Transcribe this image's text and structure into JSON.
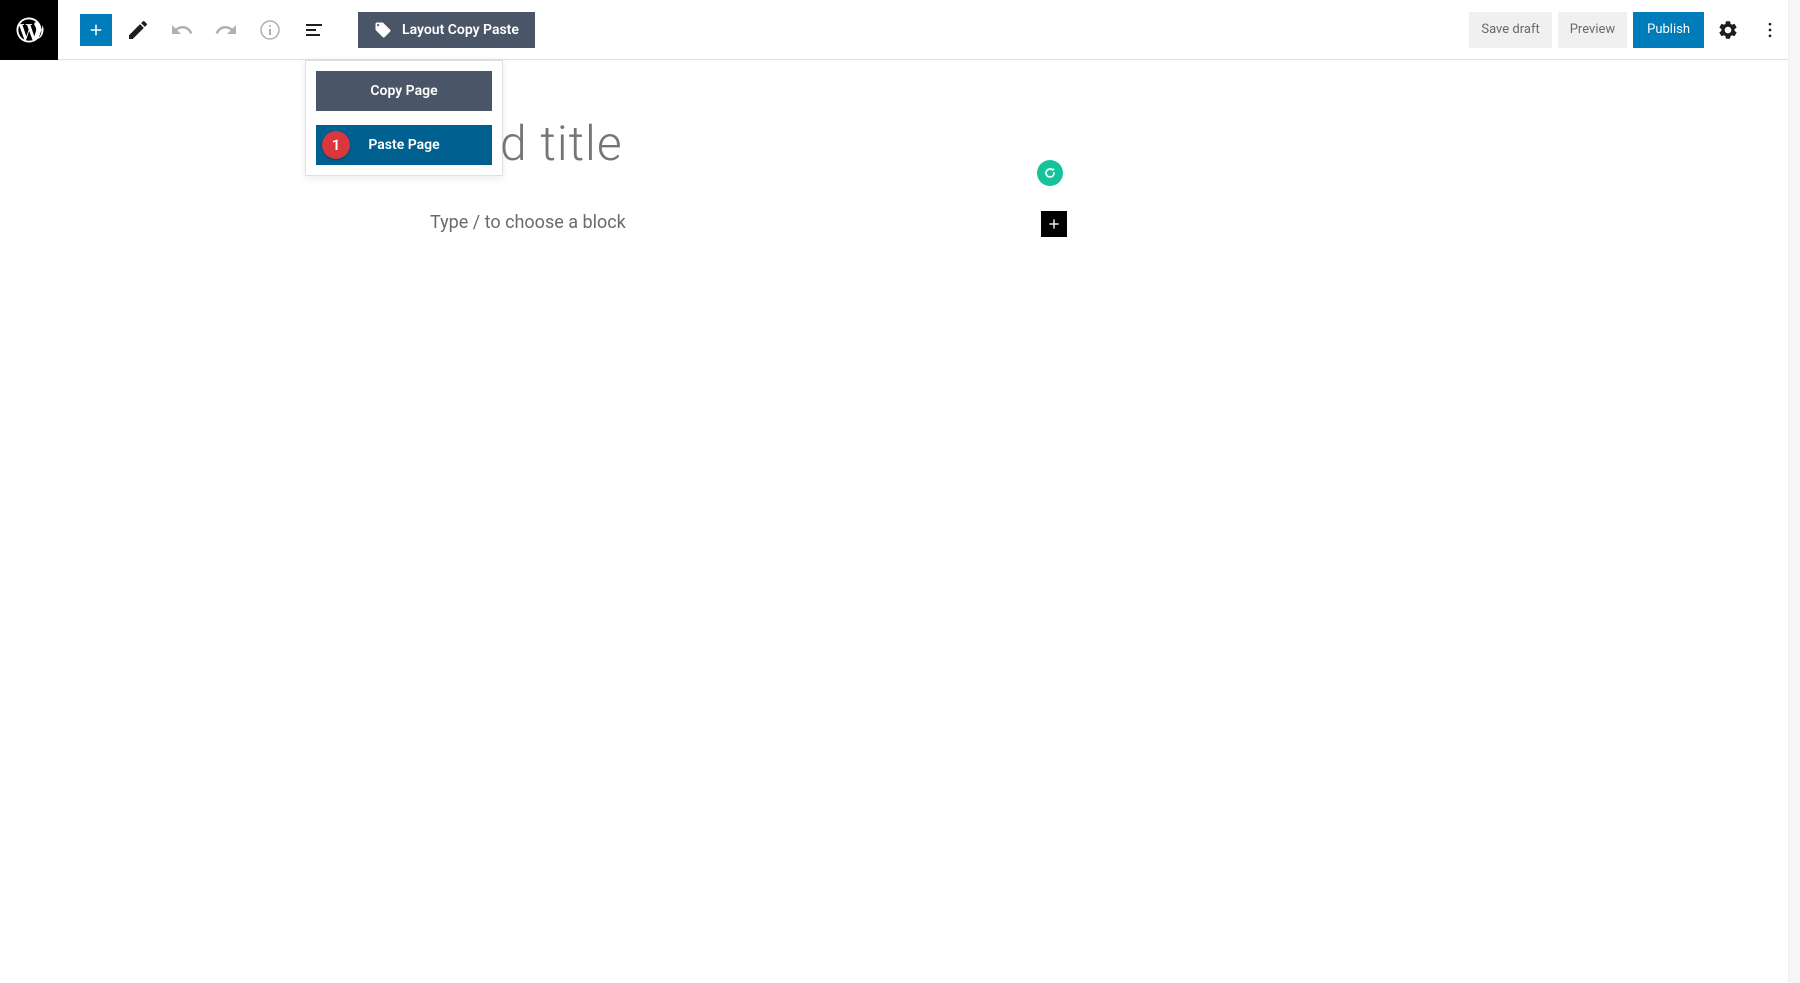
{
  "toolbar": {
    "layout_label": "Layout Copy Paste",
    "save_draft_label": "Save draft",
    "preview_label": "Preview",
    "publish_label": "Publish"
  },
  "dropdown": {
    "copy_label": "Copy Page",
    "paste_label": "Paste Page",
    "badge_number": "1"
  },
  "editor": {
    "title_placeholder_visible": "d title",
    "block_placeholder": "Type / to choose a block"
  },
  "colors": {
    "primary": "#007cba",
    "toolbar_gray": "#4a5568",
    "badge_red": "#d9363e",
    "grammarly_green": "#15c39a"
  }
}
